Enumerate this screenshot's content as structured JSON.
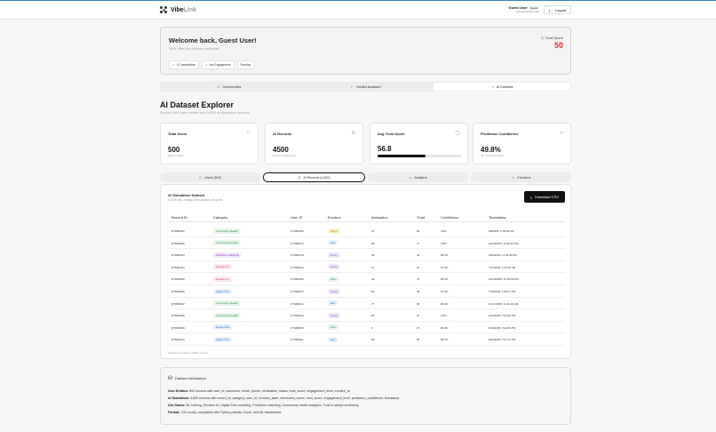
{
  "nav": {
    "logo": "VibeLink",
    "logo_main": "Vibe",
    "logo_accent": "Link",
    "user_name": "Guest User",
    "user_badge": "Guest",
    "user_email": "guest@vibelink.app",
    "logout_label": "Logout"
  },
  "welcome": {
    "title": "Welcome back, Guest User!",
    "subtitle": "Your VibeLink journey continues",
    "chips": [
      "0 Communities",
      "low Engagement",
      "Pending"
    ],
    "trust_label": "Trust Score",
    "trust_value": "50"
  },
  "main_tabs": [
    {
      "label": "Communities",
      "icon": "users-icon"
    },
    {
      "label": "VibeBot Assistant",
      "icon": "bot-icon"
    },
    {
      "label": "AI Datasets",
      "icon": "activity-icon",
      "active": true
    }
  ],
  "page": {
    "title": "AI Dataset Explorer",
    "subtitle": "Explore 500 user entities and 4,500 AI simulation records"
  },
  "stats": [
    {
      "label": "Total Users",
      "value": "500",
      "note": "Mock entities",
      "icon": "users-icon"
    },
    {
      "label": "AI Records",
      "value": "4500",
      "note": "Across 8 categories",
      "icon": "database-icon"
    },
    {
      "label": "Avg Trust Score",
      "value": "56.8",
      "progress": 0.568,
      "icon": "shield-icon"
    },
    {
      "label": "Prediction Confidence",
      "value": "49.8%",
      "note": "ML model accuracy",
      "icon": "trend-icon"
    }
  ],
  "sub_tabs": [
    {
      "label": "Users (500)",
      "icon": "users-icon"
    },
    {
      "label": "AI Records (4,500)",
      "icon": "database-icon",
      "active": true
    },
    {
      "label": "Analytics",
      "icon": "activity-icon"
    },
    {
      "label": "Emotions",
      "icon": "smile-icon"
    }
  ],
  "table": {
    "title": "AI Simulation Dataset",
    "subtitle": "4,500 ML-ready simulation records",
    "download_label": "Download CSV",
    "columns": [
      "Record ID",
      "Category",
      "User ID",
      "Emotion",
      "Interaction",
      "Trust",
      "Confidence",
      "Timestamp"
    ],
    "rows": [
      [
        "RTDB0001",
        "Community Health",
        "UTSB0120",
        "happy",
        "72",
        "69",
        "3.5%",
        "9/8/2025, 5:35:06 AM"
      ],
      [
        "RTDB0002",
        "Community Health",
        "UTSB0079",
        "sad",
        "68",
        "77",
        "6.8%",
        "12/18/2025, 11:56:46 PM"
      ],
      [
        "RTDB0003",
        "Predictive Matching",
        "UTSB0178",
        "lonely",
        "34",
        "44",
        "58.1%",
        "5/26/2025, 11:46:09 PM"
      ],
      [
        "RTDB0004",
        "Emotion AI",
        "UTSB0423",
        "lonely",
        "11",
        "26",
        "37.0%",
        "7/21/2025, 1:15:29 AM"
      ],
      [
        "RTDB0005",
        "Emotion AI",
        "UTSB0458",
        "calm",
        "42",
        "76",
        "89.5%",
        "10/15/2025, 10:01:59 PM"
      ],
      [
        "RTDB0006",
        "Digital Twin",
        "UTSB0075",
        "lonely",
        "50",
        "45",
        "67.0%",
        "7/18/2025, 1:56:07 PM"
      ],
      [
        "RTDB0007",
        "Community Health",
        "UTSB0013",
        "sad",
        "77",
        "98",
        "88.6%",
        "12/17/2025, 11:49:23 AM"
      ],
      [
        "RTDB0008",
        "Community Health",
        "UTSB0243",
        "lonely",
        "25",
        "37",
        "2.8%",
        "2/13/2025, 7:09:48 PM"
      ],
      [
        "RTDB0009",
        "Digital Twin",
        "UTSB0045",
        "calm",
        "6",
        "27",
        "96.0%",
        "6/10/2025, 8:42:09 PM"
      ],
      [
        "RTDB0010",
        "Digital Twin",
        "UTSB0491",
        "sad",
        "89",
        "35",
        "89.0%",
        "8/30/2025, 7:37:17 PM"
      ]
    ],
    "footnote": "Showing first 100 of 4500 records"
  },
  "info": {
    "title": "Dataset Information",
    "lines": [
      {
        "label": "User Entities:",
        "text": " 500 records with user_id, username, email, phone, verification_status, trust_score, engagement_level, created_at"
      },
      {
        "label": "AI Simulation:",
        "text": " 4,500 records with record_id, category, user_id, emotion_state, interaction_score, trust_score, engagement_level, prediction_confidence, timestamp"
      },
      {
        "label": "Use Cases:",
        "text": " ML training, Emotion AI, Digital Twin modeling, Predictive matching, Community health analytics, Trust & safety monitoring"
      },
      {
        "label": "Format:",
        "text": " CSV-ready, compatible with Python pandas, Excel, and ML frameworks"
      }
    ]
  },
  "colors": {
    "accent_red": "#dd3333",
    "cat": {
      "Community Health": [
        "#e6f6ea",
        "#2f8a45"
      ],
      "Predictive Matching": [
        "#f2e8fb",
        "#8a42c0"
      ],
      "Emotion AI": [
        "#fde8ee",
        "#c23c6a"
      ],
      "Digital Twin": [
        "#e6f0fc",
        "#3a6fc0"
      ]
    },
    "emo": {
      "happy": [
        "#fdf5c9",
        "#9a7a0a"
      ],
      "sad": [
        "#e4efff",
        "#3461b8"
      ],
      "lonely": [
        "#f0e6fb",
        "#7c46b5"
      ],
      "calm": [
        "#e5f7ea",
        "#2f8a45"
      ]
    }
  }
}
